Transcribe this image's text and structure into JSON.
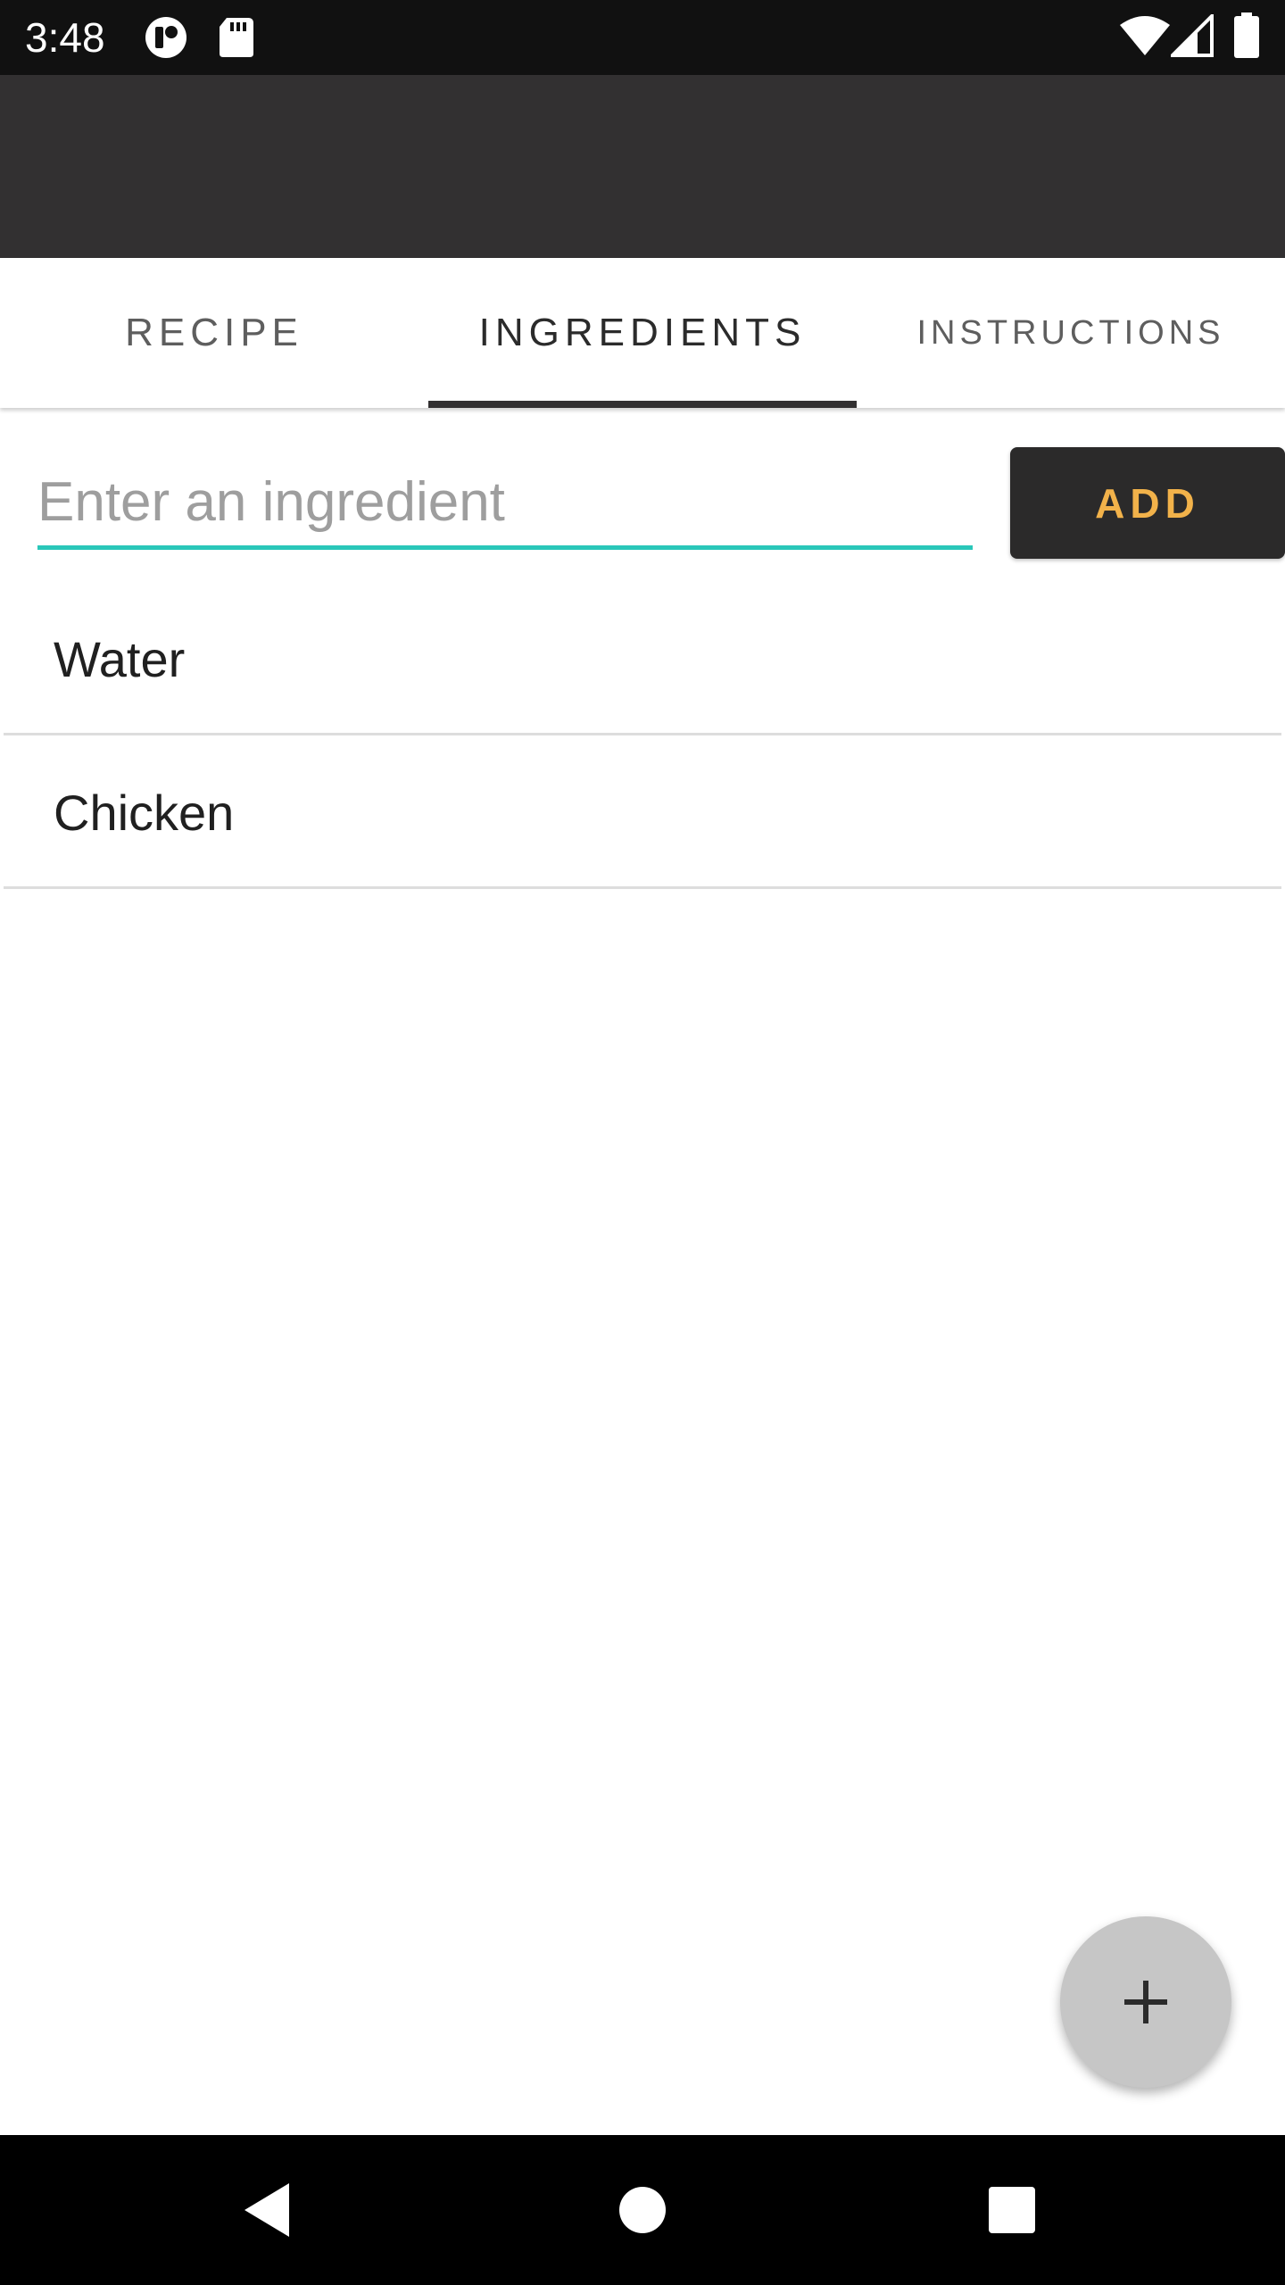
{
  "status_bar": {
    "time": "3:48",
    "left_icons": [
      "notification-app-icon",
      "sd-card-icon"
    ],
    "right_icons": [
      "wifi-icon",
      "cellular-signal-icon",
      "battery-icon"
    ]
  },
  "tabs": [
    {
      "label": "RECIPE",
      "selected": false
    },
    {
      "label": "INGREDIENTS",
      "selected": true
    },
    {
      "label": "INSTRUCTIONS",
      "selected": false
    }
  ],
  "ingredient_input": {
    "value": "",
    "placeholder": "Enter an ingredient"
  },
  "add_button": {
    "label": "ADD"
  },
  "ingredients": [
    {
      "name": "Water"
    },
    {
      "name": "Chicken"
    }
  ],
  "fab": {
    "icon": "plus-icon"
  },
  "nav_bar": {
    "icons": [
      "back-icon",
      "home-icon",
      "recents-icon"
    ]
  },
  "colors": {
    "app_bar": "#323031",
    "accent_underline": "#2ac7b9",
    "add_button_bg": "#2b2a2a",
    "add_button_text": "#f2b24a",
    "fab_bg": "#c6c6c6"
  }
}
